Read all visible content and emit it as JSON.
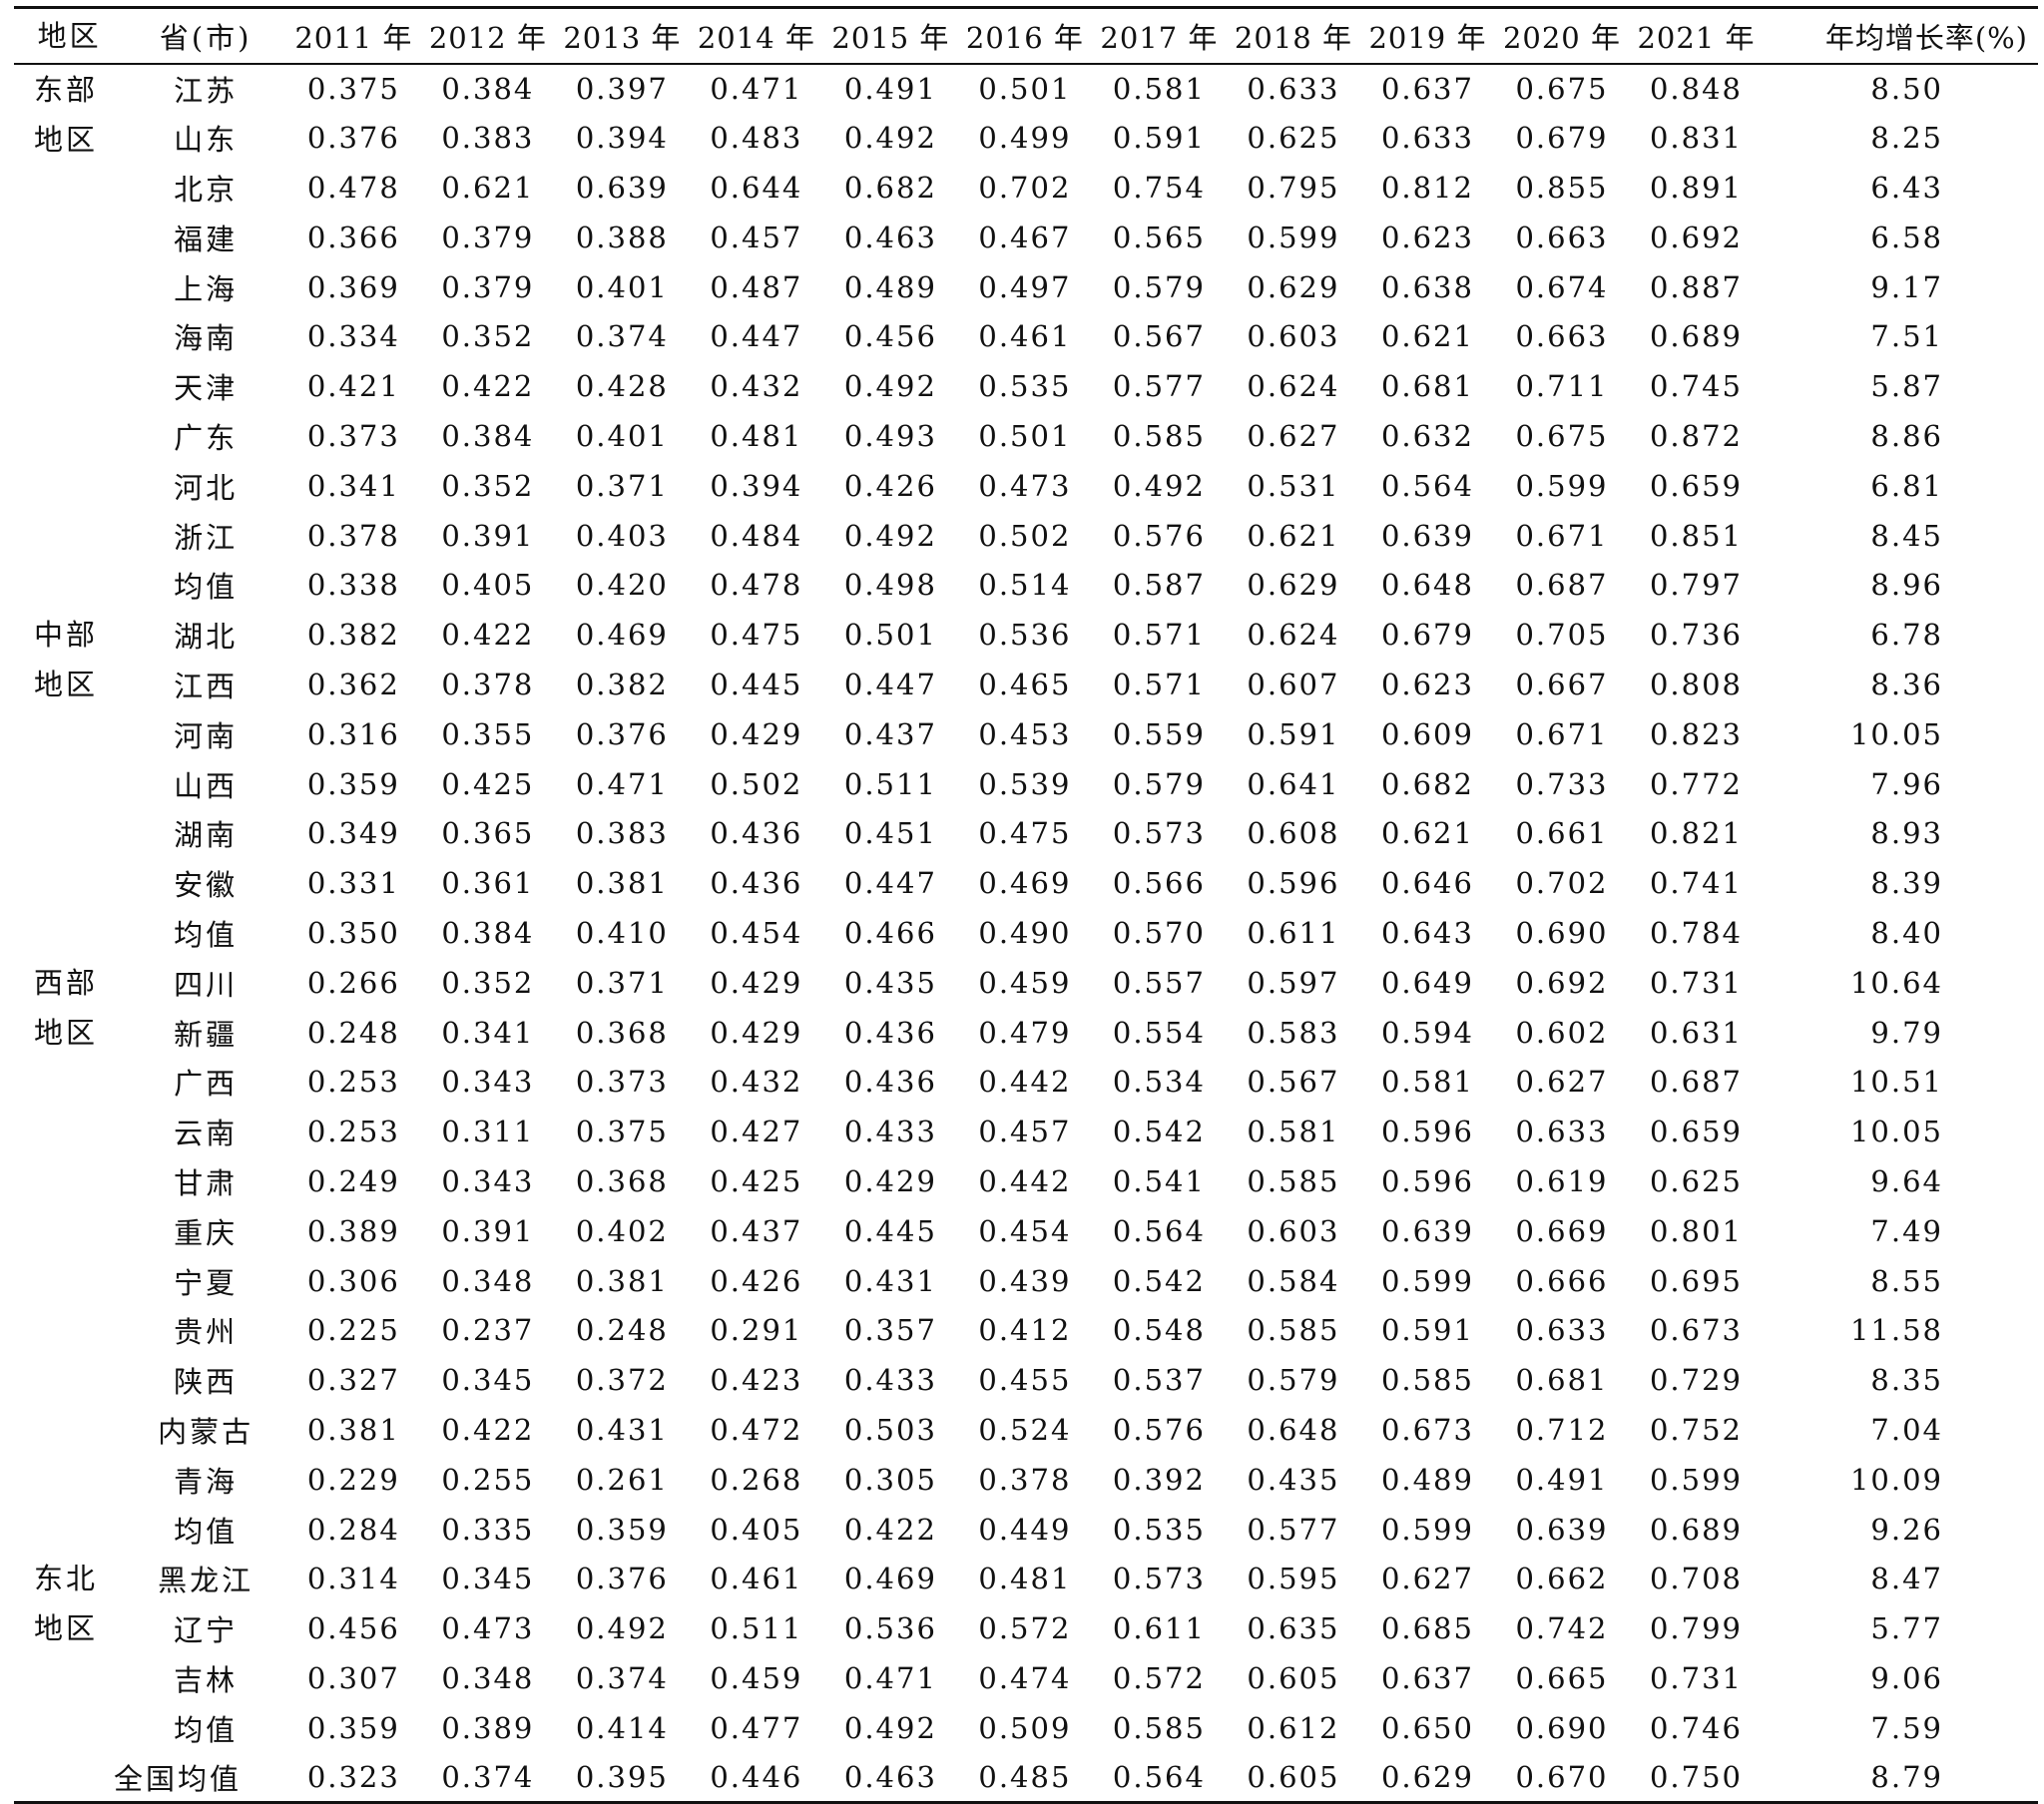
{
  "headers": [
    "地区",
    "省(市)",
    "2011 年",
    "2012 年",
    "2013 年",
    "2014 年",
    "2015 年",
    "2016 年",
    "2017 年",
    "2018 年",
    "2019 年",
    "2020 年",
    "2021 年",
    "年均增长率(%)"
  ],
  "groups": [
    {
      "region": "东部地区",
      "rows": [
        {
          "name": "江苏",
          "values": [
            "0.375",
            "0.384",
            "0.397",
            "0.471",
            "0.491",
            "0.501",
            "0.581",
            "0.633",
            "0.637",
            "0.675",
            "0.848"
          ],
          "rate": "8.50"
        },
        {
          "name": "山东",
          "values": [
            "0.376",
            "0.383",
            "0.394",
            "0.483",
            "0.492",
            "0.499",
            "0.591",
            "0.625",
            "0.633",
            "0.679",
            "0.831"
          ],
          "rate": "8.25"
        },
        {
          "name": "北京",
          "values": [
            "0.478",
            "0.621",
            "0.639",
            "0.644",
            "0.682",
            "0.702",
            "0.754",
            "0.795",
            "0.812",
            "0.855",
            "0.891"
          ],
          "rate": "6.43"
        },
        {
          "name": "福建",
          "values": [
            "0.366",
            "0.379",
            "0.388",
            "0.457",
            "0.463",
            "0.467",
            "0.565",
            "0.599",
            "0.623",
            "0.663",
            "0.692"
          ],
          "rate": "6.58"
        },
        {
          "name": "上海",
          "values": [
            "0.369",
            "0.379",
            "0.401",
            "0.487",
            "0.489",
            "0.497",
            "0.579",
            "0.629",
            "0.638",
            "0.674",
            "0.887"
          ],
          "rate": "9.17"
        },
        {
          "name": "海南",
          "values": [
            "0.334",
            "0.352",
            "0.374",
            "0.447",
            "0.456",
            "0.461",
            "0.567",
            "0.603",
            "0.621",
            "0.663",
            "0.689"
          ],
          "rate": "7.51"
        },
        {
          "name": "天津",
          "values": [
            "0.421",
            "0.422",
            "0.428",
            "0.432",
            "0.492",
            "0.535",
            "0.577",
            "0.624",
            "0.681",
            "0.711",
            "0.745"
          ],
          "rate": "5.87"
        },
        {
          "name": "广东",
          "values": [
            "0.373",
            "0.384",
            "0.401",
            "0.481",
            "0.493",
            "0.501",
            "0.585",
            "0.627",
            "0.632",
            "0.675",
            "0.872"
          ],
          "rate": "8.86"
        },
        {
          "name": "河北",
          "values": [
            "0.341",
            "0.352",
            "0.371",
            "0.394",
            "0.426",
            "0.473",
            "0.492",
            "0.531",
            "0.564",
            "0.599",
            "0.659"
          ],
          "rate": "6.81"
        },
        {
          "name": "浙江",
          "values": [
            "0.378",
            "0.391",
            "0.403",
            "0.484",
            "0.492",
            "0.502",
            "0.576",
            "0.621",
            "0.639",
            "0.671",
            "0.851"
          ],
          "rate": "8.45"
        },
        {
          "name": "均值",
          "values": [
            "0.338",
            "0.405",
            "0.420",
            "0.478",
            "0.498",
            "0.514",
            "0.587",
            "0.629",
            "0.648",
            "0.687",
            "0.797"
          ],
          "rate": "8.96"
        }
      ]
    },
    {
      "region": "中部地区",
      "rows": [
        {
          "name": "湖北",
          "values": [
            "0.382",
            "0.422",
            "0.469",
            "0.475",
            "0.501",
            "0.536",
            "0.571",
            "0.624",
            "0.679",
            "0.705",
            "0.736"
          ],
          "rate": "6.78"
        },
        {
          "name": "江西",
          "values": [
            "0.362",
            "0.378",
            "0.382",
            "0.445",
            "0.447",
            "0.465",
            "0.571",
            "0.607",
            "0.623",
            "0.667",
            "0.808"
          ],
          "rate": "8.36"
        },
        {
          "name": "河南",
          "values": [
            "0.316",
            "0.355",
            "0.376",
            "0.429",
            "0.437",
            "0.453",
            "0.559",
            "0.591",
            "0.609",
            "0.671",
            "0.823"
          ],
          "rate": "10.05"
        },
        {
          "name": "山西",
          "values": [
            "0.359",
            "0.425",
            "0.471",
            "0.502",
            "0.511",
            "0.539",
            "0.579",
            "0.641",
            "0.682",
            "0.733",
            "0.772"
          ],
          "rate": "7.96"
        },
        {
          "name": "湖南",
          "values": [
            "0.349",
            "0.365",
            "0.383",
            "0.436",
            "0.451",
            "0.475",
            "0.573",
            "0.608",
            "0.621",
            "0.661",
            "0.821"
          ],
          "rate": "8.93"
        },
        {
          "name": "安徽",
          "values": [
            "0.331",
            "0.361",
            "0.381",
            "0.436",
            "0.447",
            "0.469",
            "0.566",
            "0.596",
            "0.646",
            "0.702",
            "0.741"
          ],
          "rate": "8.39"
        },
        {
          "name": "均值",
          "values": [
            "0.350",
            "0.384",
            "0.410",
            "0.454",
            "0.466",
            "0.490",
            "0.570",
            "0.611",
            "0.643",
            "0.690",
            "0.784"
          ],
          "rate": "8.40"
        }
      ]
    },
    {
      "region": "西部地区",
      "rows": [
        {
          "name": "四川",
          "values": [
            "0.266",
            "0.352",
            "0.371",
            "0.429",
            "0.435",
            "0.459",
            "0.557",
            "0.597",
            "0.649",
            "0.692",
            "0.731"
          ],
          "rate": "10.64"
        },
        {
          "name": "新疆",
          "values": [
            "0.248",
            "0.341",
            "0.368",
            "0.429",
            "0.436",
            "0.479",
            "0.554",
            "0.583",
            "0.594",
            "0.602",
            "0.631"
          ],
          "rate": "9.79"
        },
        {
          "name": "广西",
          "values": [
            "0.253",
            "0.343",
            "0.373",
            "0.432",
            "0.436",
            "0.442",
            "0.534",
            "0.567",
            "0.581",
            "0.627",
            "0.687"
          ],
          "rate": "10.51"
        },
        {
          "name": "云南",
          "values": [
            "0.253",
            "0.311",
            "0.375",
            "0.427",
            "0.433",
            "0.457",
            "0.542",
            "0.581",
            "0.596",
            "0.633",
            "0.659"
          ],
          "rate": "10.05"
        },
        {
          "name": "甘肃",
          "values": [
            "0.249",
            "0.343",
            "0.368",
            "0.425",
            "0.429",
            "0.442",
            "0.541",
            "0.585",
            "0.596",
            "0.619",
            "0.625"
          ],
          "rate": "9.64"
        },
        {
          "name": "重庆",
          "values": [
            "0.389",
            "0.391",
            "0.402",
            "0.437",
            "0.445",
            "0.454",
            "0.564",
            "0.603",
            "0.639",
            "0.669",
            "0.801"
          ],
          "rate": "7.49"
        },
        {
          "name": "宁夏",
          "values": [
            "0.306",
            "0.348",
            "0.381",
            "0.426",
            "0.431",
            "0.439",
            "0.542",
            "0.584",
            "0.599",
            "0.666",
            "0.695"
          ],
          "rate": "8.55"
        },
        {
          "name": "贵州",
          "values": [
            "0.225",
            "0.237",
            "0.248",
            "0.291",
            "0.357",
            "0.412",
            "0.548",
            "0.585",
            "0.591",
            "0.633",
            "0.673"
          ],
          "rate": "11.58"
        },
        {
          "name": "陕西",
          "values": [
            "0.327",
            "0.345",
            "0.372",
            "0.423",
            "0.433",
            "0.455",
            "0.537",
            "0.579",
            "0.585",
            "0.681",
            "0.729"
          ],
          "rate": "8.35"
        },
        {
          "name": "内蒙古",
          "values": [
            "0.381",
            "0.422",
            "0.431",
            "0.472",
            "0.503",
            "0.524",
            "0.576",
            "0.648",
            "0.673",
            "0.712",
            "0.752"
          ],
          "rate": "7.04"
        },
        {
          "name": "青海",
          "values": [
            "0.229",
            "0.255",
            "0.261",
            "0.268",
            "0.305",
            "0.378",
            "0.392",
            "0.435",
            "0.489",
            "0.491",
            "0.599"
          ],
          "rate": "10.09"
        },
        {
          "name": "均值",
          "values": [
            "0.284",
            "0.335",
            "0.359",
            "0.405",
            "0.422",
            "0.449",
            "0.535",
            "0.577",
            "0.599",
            "0.639",
            "0.689"
          ],
          "rate": "9.26"
        }
      ]
    },
    {
      "region": "东北地区",
      "rows": [
        {
          "name": "黑龙江",
          "values": [
            "0.314",
            "0.345",
            "0.376",
            "0.461",
            "0.469",
            "0.481",
            "0.573",
            "0.595",
            "0.627",
            "0.662",
            "0.708"
          ],
          "rate": "8.47"
        },
        {
          "name": "辽宁",
          "values": [
            "0.456",
            "0.473",
            "0.492",
            "0.511",
            "0.536",
            "0.572",
            "0.611",
            "0.635",
            "0.685",
            "0.742",
            "0.799"
          ],
          "rate": "5.77"
        },
        {
          "name": "吉林",
          "values": [
            "0.307",
            "0.348",
            "0.374",
            "0.459",
            "0.471",
            "0.474",
            "0.572",
            "0.605",
            "0.637",
            "0.665",
            "0.731"
          ],
          "rate": "9.06"
        },
        {
          "name": "均值",
          "values": [
            "0.359",
            "0.389",
            "0.414",
            "0.477",
            "0.492",
            "0.509",
            "0.585",
            "0.612",
            "0.650",
            "0.690",
            "0.746"
          ],
          "rate": "7.59"
        }
      ]
    }
  ],
  "national": {
    "name": "全国均值",
    "values": [
      "0.323",
      "0.374",
      "0.395",
      "0.446",
      "0.463",
      "0.485",
      "0.564",
      "0.605",
      "0.629",
      "0.670",
      "0.750"
    ],
    "rate": "8.79"
  }
}
